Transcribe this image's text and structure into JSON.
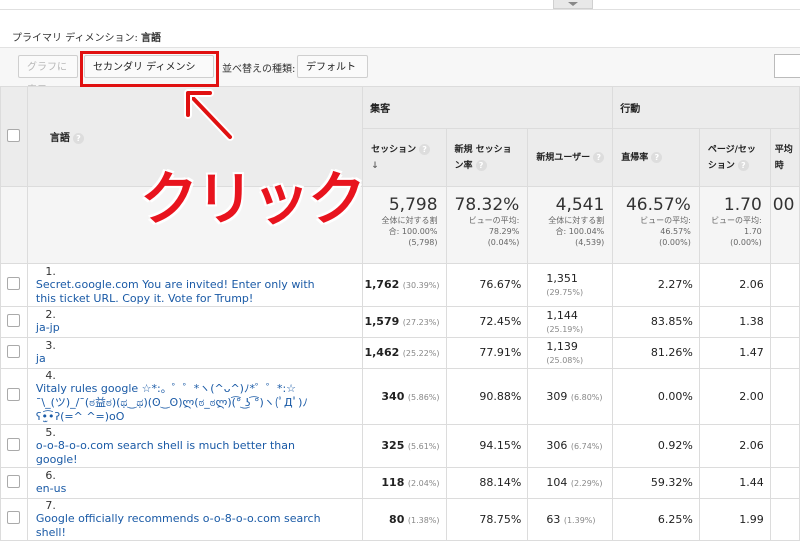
{
  "primary_dimension": {
    "label": "プライマリ ディメンション:",
    "value": "言語"
  },
  "toolbar": {
    "chart_label": "グラフに表示",
    "secondary_dimension_label": "セカンダリ ディメンション",
    "sort_type_label": "並べ替えの種類:",
    "sort_default_label": "デフォルト"
  },
  "annotation": {
    "click_text": "クリック"
  },
  "header_groups": {
    "acquisition": "集客",
    "behavior": "行動"
  },
  "columns": {
    "language": "言語",
    "sessions": "セッション",
    "new_session_rate": "新規 セッション率",
    "new_users": "新規ユーザー",
    "bounce_rate": "直帰率",
    "pages_per_session": "ページ/セッション",
    "avg_duration_partial": "平均 時"
  },
  "totals": {
    "sessions": {
      "value": "5,798",
      "note1": "全体に対する割",
      "note2": "合: 100.00%",
      "note3": "(5,798)"
    },
    "new_session_rate": {
      "value": "78.32%",
      "note1": "ビューの平均:",
      "note2": "78.29%",
      "note3": "(0.04%)"
    },
    "new_users": {
      "value": "4,541",
      "note1": "全体に対する割",
      "note2": "合: 100.04%",
      "note3": "(4,539)"
    },
    "bounce_rate": {
      "value": "46.57%",
      "note1": "ビューの平均:",
      "note2": "46.57%",
      "note3": "(0.00%)"
    },
    "pages_per_session": {
      "value": "1.70",
      "note1": "ビューの平均:",
      "note2": "1.70",
      "note3": "(0.00%)"
    },
    "avg_partial": {
      "value": "00"
    }
  },
  "rows": [
    {
      "idx": "1.",
      "lang": "Secret.ɢoogle.com You are invited! Enter only with this ticket URL. Copy it. Vote for Trump!",
      "sessions": "1,762",
      "sessions_pct": "(30.39%)",
      "nsr": "76.67%",
      "users": "1,351",
      "users_pct": "(29.75%)",
      "bounce": "2.27%",
      "pps": "2.06"
    },
    {
      "idx": "2.",
      "lang": "ja-jp",
      "sessions": "1,579",
      "sessions_pct": "(27.23%)",
      "nsr": "72.45%",
      "users": "1,144",
      "users_pct": "(25.19%)",
      "bounce": "83.85%",
      "pps": "1.38"
    },
    {
      "idx": "3.",
      "lang": "ja",
      "sessions": "1,462",
      "sessions_pct": "(25.22%)",
      "nsr": "77.91%",
      "users": "1,139",
      "users_pct": "(25.08%)",
      "bounce": "81.26%",
      "pps": "1.47"
    },
    {
      "idx": "4.",
      "lang": "Vitaly rules google ☆*:。゜゜*ヽ(^ᴗ^)ﾉ*゜゜*:☆ ¯\\_(ツ)_/¯(ಠ益ಠ)(ಥ‿ಥ)(ʘ‿ʘ)ლ(ಠ_ಠლ)(͡° ͜ʖ ͡°)ヽ(ﾟДﾟ)ﾉʕ•̫͡•ʔ(=^ ^=)oO",
      "sessions": "340",
      "sessions_pct": "(5.86%)",
      "nsr": "90.88%",
      "users": "309",
      "users_pct": "(6.80%)",
      "bounce": "0.00%",
      "pps": "2.00"
    },
    {
      "idx": "5.",
      "lang": "o-o-8-o-o.com search shell is much better than google!",
      "sessions": "325",
      "sessions_pct": "(5.61%)",
      "nsr": "94.15%",
      "users": "306",
      "users_pct": "(6.74%)",
      "bounce": "0.92%",
      "pps": "2.06"
    },
    {
      "idx": "6.",
      "lang": "en-us",
      "sessions": "118",
      "sessions_pct": "(2.04%)",
      "nsr": "88.14%",
      "users": "104",
      "users_pct": "(2.29%)",
      "bounce": "59.32%",
      "pps": "1.44"
    },
    {
      "idx": "7.",
      "lang": "Google officially recommends o-o-8-o-o.com search shell!",
      "sessions": "80",
      "sessions_pct": "(1.38%)",
      "nsr": "78.75%",
      "users": "63",
      "users_pct": "(1.39%)",
      "bounce": "6.25%",
      "pps": "1.99"
    }
  ]
}
